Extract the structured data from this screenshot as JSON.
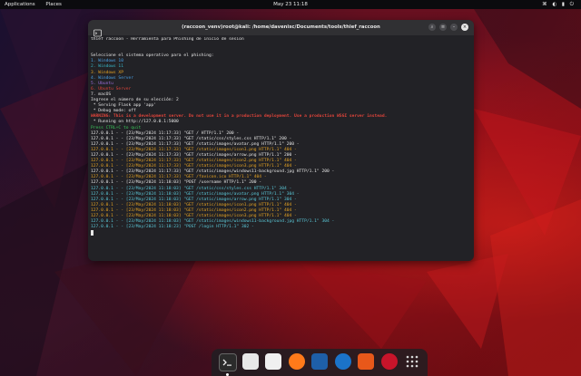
{
  "topbar": {
    "applications": "Applications",
    "places": "Places",
    "clock": "May 23  11:18",
    "status_icons": "⌘ ◐ ▮ ⏻"
  },
  "terminal": {
    "title": "(raccoon_venv)root@kali: /home/davenisc/Documents/tools/thief_raccoon",
    "lines": [
      {
        "text": "thief raccoon - Herramienta para Phishing de inicio de sesion",
        "color": ""
      },
      {
        "text": "",
        "color": ""
      },
      {
        "text": "",
        "color": ""
      },
      {
        "text": "Seleccione el sistema operativo para el phishing:",
        "color": ""
      },
      {
        "text": "1. Windows 10",
        "color": "c-blue"
      },
      {
        "text": "2. Windows 11",
        "color": "c-teal"
      },
      {
        "text": "3. Windows XP",
        "color": "c-orange"
      },
      {
        "text": "4. Windows Server",
        "color": "c-blue"
      },
      {
        "text": "5. Ubuntu",
        "color": "c-purple"
      },
      {
        "text": "6. Ubuntu Server",
        "color": "c-red"
      },
      {
        "text": "7. macOS",
        "color": ""
      },
      {
        "text": "Ingrese el número de su elección: 2",
        "color": ""
      },
      {
        "text": " * Serving Flask app 'app'",
        "color": ""
      },
      {
        "text": " * Debug mode: off",
        "color": ""
      },
      {
        "text": "WARNING: This is a development server. Do not use it in a production deployment. Use a production WSGI server instead.",
        "color": "c-warn"
      },
      {
        "text": " * Running on http://127.0.0.1:5000",
        "color": ""
      },
      {
        "text": "Press CTRL+C to quit",
        "color": "c-green"
      },
      {
        "text": "127.0.0.1 - - [23/May/2024 11:17:33] \"GET / HTTP/1.1\" 200 -",
        "color": ""
      },
      {
        "text": "127.0.0.1 - - [23/May/2024 11:17:33] \"GET /static/css/styles.css HTTP/1.1\" 200 -",
        "color": ""
      },
      {
        "text": "127.0.0.1 - - [23/May/2024 11:17:33] \"GET /static/images/avatar.png HTTP/1.1\" 200 -",
        "color": ""
      },
      {
        "text": "127.0.0.1 - - [23/May/2024 11:17:33] \"GET /static/images/icon1.png HTTP/1.1\" 404 -",
        "color": "c-orange"
      },
      {
        "text": "127.0.0.1 - - [23/May/2024 11:17:33] \"GET /static/images/arrow.png HTTP/1.1\" 200 -",
        "color": ""
      },
      {
        "text": "127.0.0.1 - - [23/May/2024 11:17:33] \"GET /static/images/icon2.png HTTP/1.1\" 404 -",
        "color": "c-orange"
      },
      {
        "text": "127.0.0.1 - - [23/May/2024 11:17:33] \"GET /static/images/icon3.png HTTP/1.1\" 404 -",
        "color": "c-orange"
      },
      {
        "text": "127.0.0.1 - - [23/May/2024 11:17:33] \"GET /static/images/windows11-background.jpg HTTP/1.1\" 200 -",
        "color": ""
      },
      {
        "text": "127.0.0.1 - - [23/May/2024 11:17:33] \"GET /favicon.ico HTTP/1.1\" 404 -",
        "color": "c-orange"
      },
      {
        "text": "127.0.0.1 - - [23/May/2024 11:18:03] \"POST /username HTTP/1.1\" 200 -",
        "color": ""
      },
      {
        "text": "127.0.0.1 - - [23/May/2024 11:18:03] \"GET /static/css/styles.css HTTP/1.1\" 304 -",
        "color": "c-cyan"
      },
      {
        "text": "127.0.0.1 - - [23/May/2024 11:18:03] \"GET /static/images/avatar.png HTTP/1.1\" 304 -",
        "color": "c-cyan"
      },
      {
        "text": "127.0.0.1 - - [23/May/2024 11:18:03] \"GET /static/images/arrow.png HTTP/1.1\" 304 -",
        "color": "c-cyan"
      },
      {
        "text": "127.0.0.1 - - [23/May/2024 11:18:03] \"GET /static/images/icon1.png HTTP/1.1\" 404 -",
        "color": "c-orange"
      },
      {
        "text": "127.0.0.1 - - [23/May/2024 11:18:03] \"GET /static/images/icon2.png HTTP/1.1\" 404 -",
        "color": "c-orange"
      },
      {
        "text": "127.0.0.1 - - [23/May/2024 11:18:03] \"GET /static/images/icon3.png HTTP/1.1\" 404 -",
        "color": "c-orange"
      },
      {
        "text": "127.0.0.1 - - [23/May/2024 11:18:03] \"GET /static/images/windows11-background.jpg HTTP/1.1\" 304 -",
        "color": "c-cyan"
      },
      {
        "text": "127.0.0.1 - - [23/May/2024 11:18:23] \"POST /login HTTP/1.1\" 302 -",
        "color": "c-cyan"
      }
    ]
  },
  "dock": {
    "items": [
      {
        "name": "terminal-app-icon",
        "color": "#2b2b2b"
      },
      {
        "name": "files-app-icon",
        "color": "#e8e8e8"
      },
      {
        "name": "text-editor-app-icon",
        "color": "#f0f0f0"
      },
      {
        "name": "firefox-app-icon",
        "color": "#ff7a1a"
      },
      {
        "name": "metasploit-app-icon",
        "color": "#1e5fa8"
      },
      {
        "name": "wireshark-app-icon",
        "color": "#1b73c9"
      },
      {
        "name": "burpsuite-app-icon",
        "color": "#e8581a"
      },
      {
        "name": "cherrytree-app-icon",
        "color": "#c8142a"
      },
      {
        "name": "app-grid-icon",
        "color": "#d8d8d8"
      }
    ]
  }
}
